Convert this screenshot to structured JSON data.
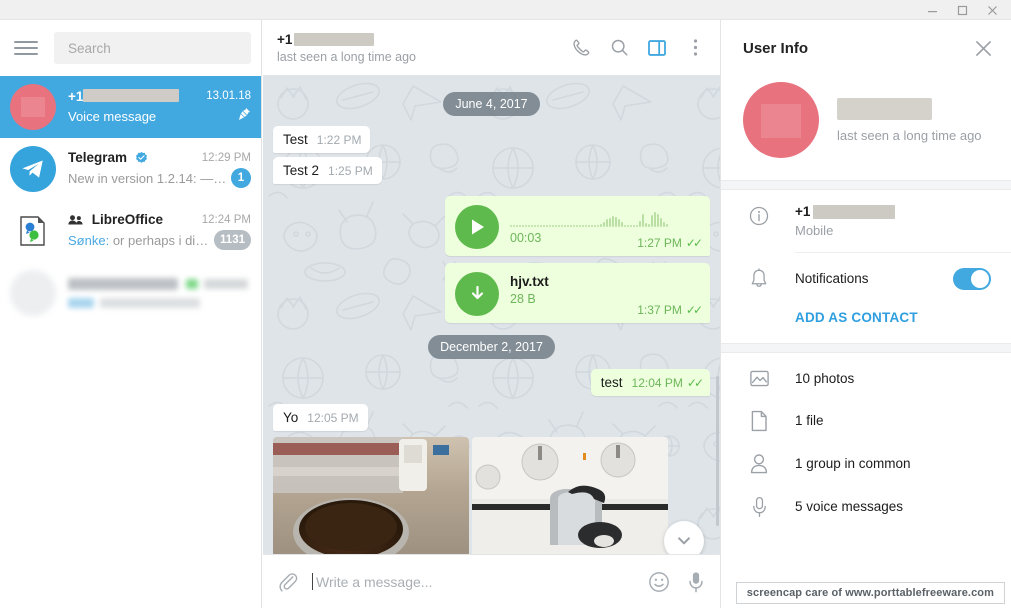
{
  "window": {
    "controls": [
      {
        "name": "minimize",
        "glyph": "minimize-icon"
      },
      {
        "name": "maximize",
        "glyph": "maximize-icon"
      },
      {
        "name": "close",
        "glyph": "close-icon"
      }
    ]
  },
  "sidebar": {
    "menu_icon": "hamburger-menu-icon",
    "search_placeholder": "Search",
    "chats": [
      {
        "name_prefix": "+1",
        "name_redacted": true,
        "time": "13.01.18",
        "preview": "Voice message",
        "sender": "",
        "badge": "",
        "pinned": true,
        "active": true,
        "avatar": "red-circle-avatar",
        "verified": false
      },
      {
        "name_prefix": "Telegram",
        "name_redacted": false,
        "time": "12:29 PM",
        "preview": "New in version 1.2.14:  —…",
        "sender": "",
        "badge": "1",
        "badge_color": "#41a8e0",
        "pinned": false,
        "active": false,
        "avatar": "telegram-logo-avatar",
        "verified": true
      },
      {
        "name_prefix": "LibreOffice",
        "name_redacted": false,
        "time": "12:24 PM",
        "preview": "or perhaps i di…",
        "sender": "Sønke:",
        "badge": "1131",
        "badge_color": "#b6bdc3",
        "pinned": false,
        "active": false,
        "avatar": "libreoffice-document-avatar",
        "verified": false,
        "is_group": true
      },
      {
        "name_prefix": "",
        "name_redacted": true,
        "time": "",
        "preview": "",
        "sender": "",
        "badge": "",
        "pinned": false,
        "active": false,
        "avatar": "blurred-avatar",
        "blurred": true,
        "verified": false
      }
    ]
  },
  "chat_header": {
    "name_prefix": "+1",
    "name_redacted": true,
    "status": "last seen a long time ago",
    "icons": [
      "phone-icon",
      "search-icon",
      "info-panel-icon",
      "more-options-icon"
    ]
  },
  "conversation": {
    "items": [
      {
        "type": "date",
        "text": "June 4, 2017"
      },
      {
        "type": "text",
        "dir": "in",
        "text": "Test",
        "time": "1:22 PM"
      },
      {
        "type": "text",
        "dir": "in",
        "text": "Test 2",
        "time": "1:25 PM"
      },
      {
        "type": "voice",
        "dir": "out",
        "duration": "00:03",
        "time": "1:27 PM",
        "read": true
      },
      {
        "type": "file",
        "dir": "out",
        "filename": "hjv.txt",
        "size": "28 B",
        "time": "1:37 PM",
        "read": true
      },
      {
        "type": "date",
        "text": "December 2, 2017"
      },
      {
        "type": "text",
        "dir": "out",
        "text": "test",
        "time": "12:04 PM",
        "read": true
      },
      {
        "type": "text",
        "dir": "in",
        "text": "Yo",
        "time": "12:05 PM"
      },
      {
        "type": "photos",
        "dir": "in",
        "count": 2,
        "captions": [
          "coffee-grounds-photo",
          "stovetop-kettle-photo"
        ]
      }
    ],
    "scroll_down_icon": "chevron-down-icon"
  },
  "composer": {
    "attach_icon": "paperclip-icon",
    "placeholder": "Write a message...",
    "emoji_icon": "emoji-smiley-icon",
    "mic_icon": "microphone-icon"
  },
  "info_panel": {
    "title": "User Info",
    "close_icon": "close-icon",
    "profile": {
      "name_redacted": true,
      "status": "last seen a long time ago",
      "avatar": "red-circle-avatar"
    },
    "phone": {
      "icon": "info-circle-icon",
      "prefix": "+1",
      "number_redacted": true,
      "label": "Mobile"
    },
    "notifications": {
      "icon": "bell-icon",
      "label": "Notifications",
      "enabled": true,
      "accent": "#41a8e0"
    },
    "add_as_contact": "ADD AS CONTACT",
    "media": [
      {
        "icon": "photo-icon",
        "label": "10 photos"
      },
      {
        "icon": "file-icon",
        "label": "1 file"
      },
      {
        "icon": "person-icon",
        "label": "1 group in common"
      },
      {
        "icon": "microphone-icon",
        "label": "5 voice messages"
      }
    ]
  },
  "watermark": "screencap care of www.porttablefreeware.com",
  "colors": {
    "accent": "#41a8e0",
    "out_bubble": "#eeffde",
    "in_bubble": "#ffffff",
    "chat_bg": "#dfe4e8",
    "green": "#5eba4c",
    "avatar_red": "#e8737f"
  }
}
